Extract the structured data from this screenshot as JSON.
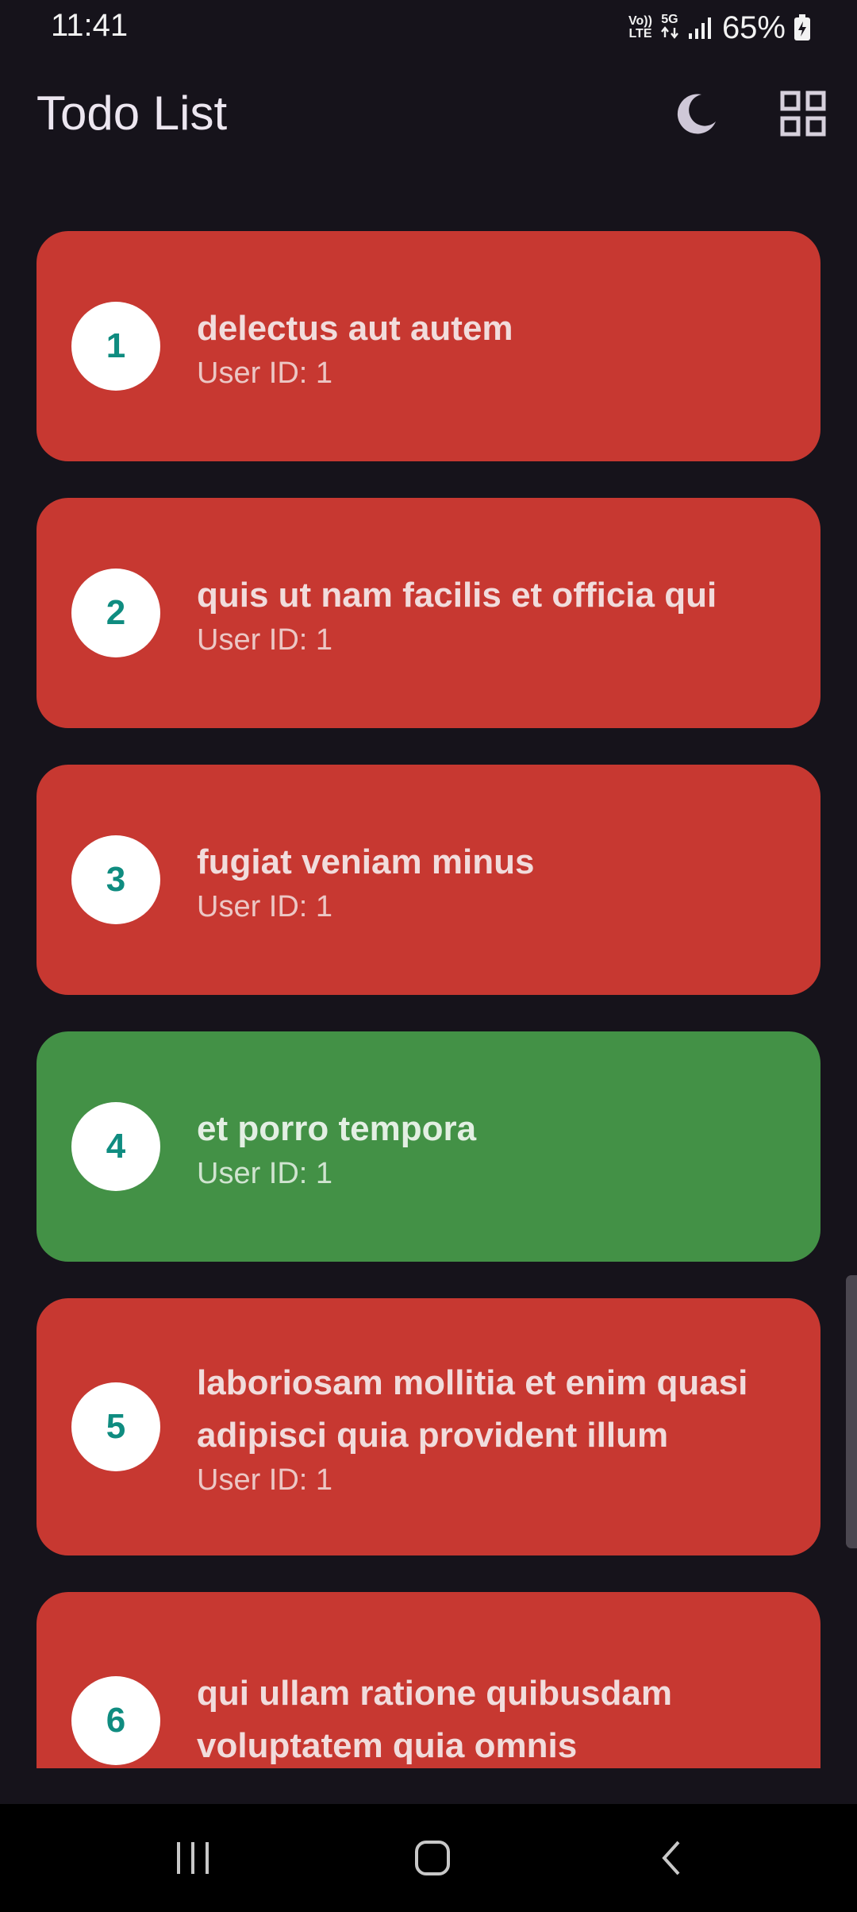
{
  "status_bar": {
    "time": "11:41",
    "network_top": "Vo))",
    "network_bottom": "LTE",
    "signal_type": "5G",
    "battery": "65%"
  },
  "app_bar": {
    "title": "Todo List",
    "icons": [
      "moon-icon",
      "grid-view-icon"
    ]
  },
  "todos": [
    {
      "number": "1",
      "title": "delectus aut autem",
      "user": "User ID: 1",
      "color": "#c73831"
    },
    {
      "number": "2",
      "title": "quis ut nam facilis et officia qui",
      "user": "User ID: 1",
      "color": "#c73831"
    },
    {
      "number": "3",
      "title": "fugiat veniam minus",
      "user": "User ID: 1",
      "color": "#c73831"
    },
    {
      "number": "4",
      "title": "et porro tempora",
      "user": "User ID: 1",
      "color": "#439146"
    },
    {
      "number": "5",
      "title": "laboriosam mollitia et enim quasi adipisci quia provident illum",
      "user": "User ID: 1",
      "color": "#c73831"
    },
    {
      "number": "6",
      "title": "qui ullam ratione quibusdam voluptatem quia omnis",
      "user": "",
      "color": "#c73831"
    }
  ],
  "nav_bar": {
    "icons": [
      "recent-apps-icon",
      "home-icon",
      "back-icon"
    ]
  }
}
